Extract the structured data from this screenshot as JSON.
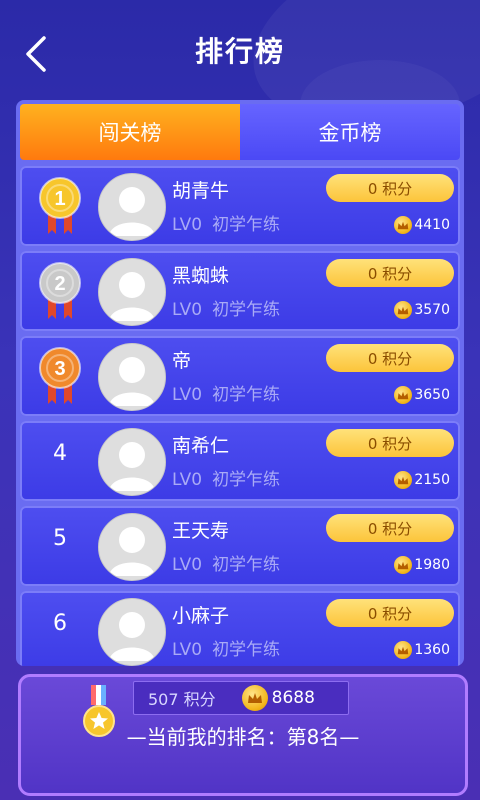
{
  "header": {
    "title": "排行榜"
  },
  "tabs": [
    {
      "label": "闯关榜",
      "active": true
    },
    {
      "label": "金币榜",
      "active": false
    }
  ],
  "leaderboard": [
    {
      "rank": "1",
      "medal": "gold",
      "name": "胡青牛",
      "level": "LV0",
      "title": "初学乍练",
      "score": "0 积分",
      "coins": "4410"
    },
    {
      "rank": "2",
      "medal": "silver",
      "name": "黑蜘蛛",
      "level": "LV0",
      "title": "初学乍练",
      "score": "0 积分",
      "coins": "3570"
    },
    {
      "rank": "3",
      "medal": "bronze",
      "name": "帝",
      "level": "LV0",
      "title": "初学乍练",
      "score": "0 积分",
      "coins": "3650"
    },
    {
      "rank": "4",
      "medal": "",
      "name": "南希仁",
      "level": "LV0",
      "title": "初学乍练",
      "score": "0 积分",
      "coins": "2150"
    },
    {
      "rank": "5",
      "medal": "",
      "name": "王天寿",
      "level": "LV0",
      "title": "初学乍练",
      "score": "0 积分",
      "coins": "1980"
    },
    {
      "rank": "6",
      "medal": "",
      "name": "小麻子",
      "level": "LV0",
      "title": "初学乍练",
      "score": "0 积分",
      "coins": "1360"
    }
  ],
  "mine": {
    "score": "507 积分",
    "coins": "8688",
    "rank_text": "—当前我的排名：第8名—"
  },
  "colors": {
    "gold": "#f7c62c",
    "silver": "#c9c9c9",
    "bronze": "#f0892c",
    "ribbon": "#e0482a"
  }
}
